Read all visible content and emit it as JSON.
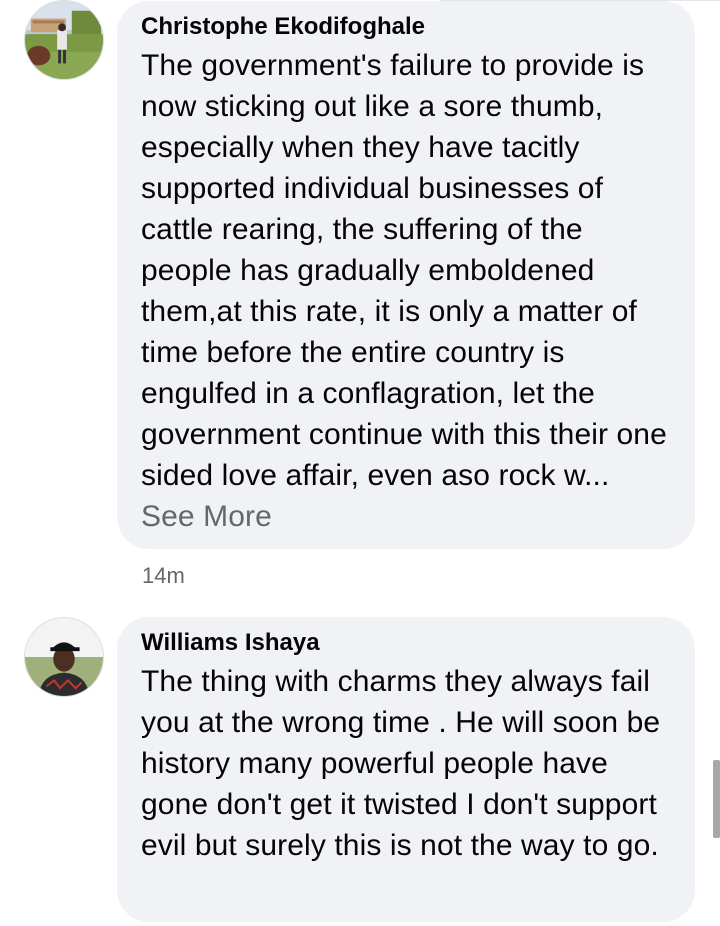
{
  "comments": [
    {
      "author": "Christophe Ekodifoghale",
      "text": "The government's failure to provide is now sticking out like a sore thumb, especially when they have tacitly supported individual businesses of cattle rearing, the suffering of the people has gradually emboldened them,at this rate, it is only a matter of time before the entire country is engulfed in a conflagration, let the government continue with this their one sided love affair, even aso rock w...",
      "see_more": "See More",
      "time": "14m",
      "avatar_icon": "profile-photo-outdoor"
    },
    {
      "author": "Williams Ishaya",
      "text": "The thing with charms they always fail you at the wrong time . He will soon be history many powerful people have gone don't get it twisted I don't support evil but surely this is not the way to go.",
      "avatar_icon": "profile-photo-cap"
    }
  ],
  "colors": {
    "bubble": "#f0f2f5",
    "text": "#050505",
    "muted": "#65676b"
  }
}
